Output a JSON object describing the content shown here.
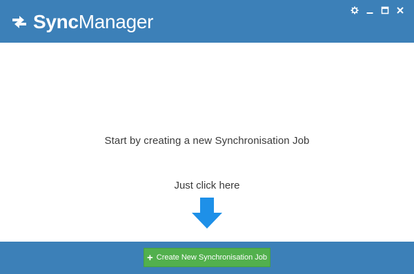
{
  "app": {
    "title_bold": "Sync",
    "title_regular": "Manager"
  },
  "window_controls": {
    "settings_icon": "gear-icon",
    "minimize_icon": "minimize-icon",
    "maximize_icon": "maximize-icon",
    "close_icon": "close-icon"
  },
  "main": {
    "prompt": "Start by creating a new Synchronisation Job",
    "hint": "Just click here",
    "arrow_icon": "arrow-down-icon"
  },
  "footer": {
    "create_button_icon": "+",
    "create_button_label": "Create New Synchronisation Job"
  },
  "colors": {
    "brand_blue": "#3c80b8",
    "arrow_blue": "#1e90e8",
    "button_green": "#52b04d"
  }
}
